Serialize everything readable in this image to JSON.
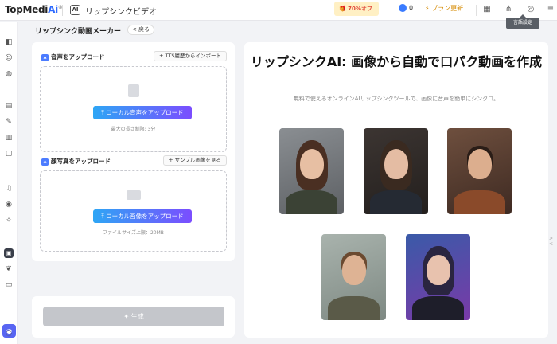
{
  "topbar": {
    "logo_main": "TopMedi",
    "logo_ai": "Ai",
    "logo_reg": "®",
    "ai_badge": "AI",
    "app_title": "リップシンクビデオ",
    "promo": "70%オフ",
    "credits": "0",
    "plan_label": "プラン更新",
    "tooltip": "言語設定"
  },
  "sidebar": {
    "active_label": "▣"
  },
  "header": {
    "title": "リップシンク動画メーカー",
    "back_label": "< 戻る"
  },
  "audio": {
    "label": "音声をアップロード",
    "tts_button": "+ TTS履歴からインポート",
    "upload_button": "⤒ ローカル音声をアップロード",
    "hint": "最大の長さ制限: 3分"
  },
  "photo": {
    "label": "顔写真をアップロード",
    "sample_button": "+ サンプル画像を見る",
    "upload_button": "⤒ ローカル画像をアップロード",
    "hint": "ファイルサイズ上限：20MB"
  },
  "generate": {
    "label": "✦ 生成"
  },
  "main": {
    "headline": "リップシンクAI: 画像から自動で口パク動画を作成",
    "subtitle": "無料で使えるオンラインAIリップシンクツールで、画像に音声を簡単にシンクロ。"
  },
  "colors": {
    "accent_start": "#2ea6f5",
    "accent_end": "#7b4dff",
    "brand_blue": "#2e6bff",
    "disabled": "#c4c6cb"
  }
}
